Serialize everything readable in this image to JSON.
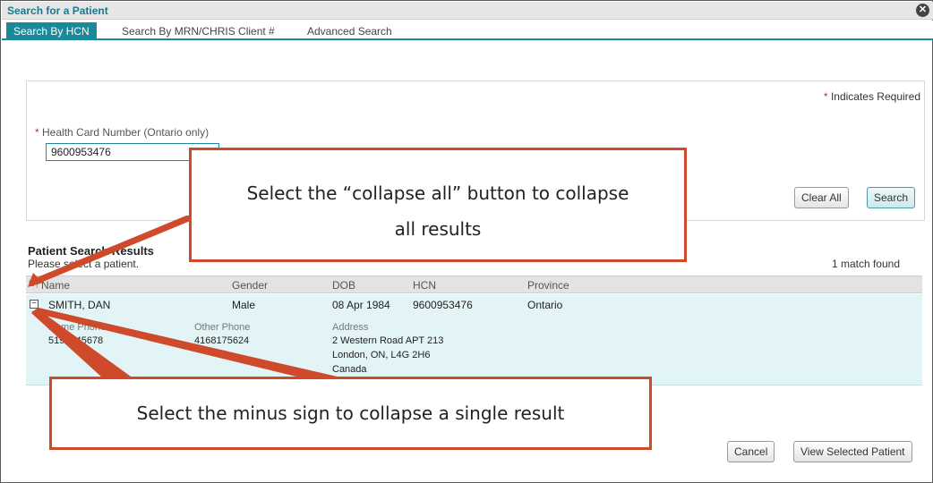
{
  "dialog": {
    "title": "Search for a Patient",
    "close_icon": "close-icon"
  },
  "tabs": [
    {
      "label": "Search By HCN",
      "active": true
    },
    {
      "label": "Search By MRN/CHRIS Client #",
      "active": false
    },
    {
      "label": "Advanced Search",
      "active": false
    }
  ],
  "form": {
    "required_star": "*",
    "required_note": "Indicates Required",
    "hcn_label": "Health Card Number (Ontario only)",
    "hcn_value": "9600953476",
    "clear_all_label": "Clear All",
    "search_label": "Search"
  },
  "results": {
    "heading": "Patient Search Results",
    "subtext": "Please select a patient.",
    "match_count": "1 match found",
    "columns": [
      "Name",
      "Gender",
      "DOB",
      "HCN",
      "Province"
    ],
    "rows": [
      {
        "name": "SMITH, DAN",
        "gender": "Male",
        "dob": "08 Apr 1984",
        "hcn": "9600953476",
        "province": "Ontario",
        "home_phone_label": "Home Phone",
        "home_phone": "5192345678",
        "other_phone_label": "Other Phone",
        "other_phone": "4168175624",
        "address_label": "Address",
        "address_line1": "2 Western Road APT 213",
        "address_line2": "London, ON, L4G 2H6",
        "address_line3": "Canada"
      }
    ]
  },
  "footer": {
    "cancel_label": "Cancel",
    "view_label": "View Selected Patient"
  },
  "annotations": {
    "collapse_all_line1": "Select the “collapse all” button to collapse",
    "collapse_all_line2": "all results",
    "collapse_single": "Select the minus sign to collapse a single result"
  },
  "colors": {
    "accent": "#1a8a9a",
    "callout": "#cf4a2a",
    "row_highlight": "#e2f4f6"
  }
}
